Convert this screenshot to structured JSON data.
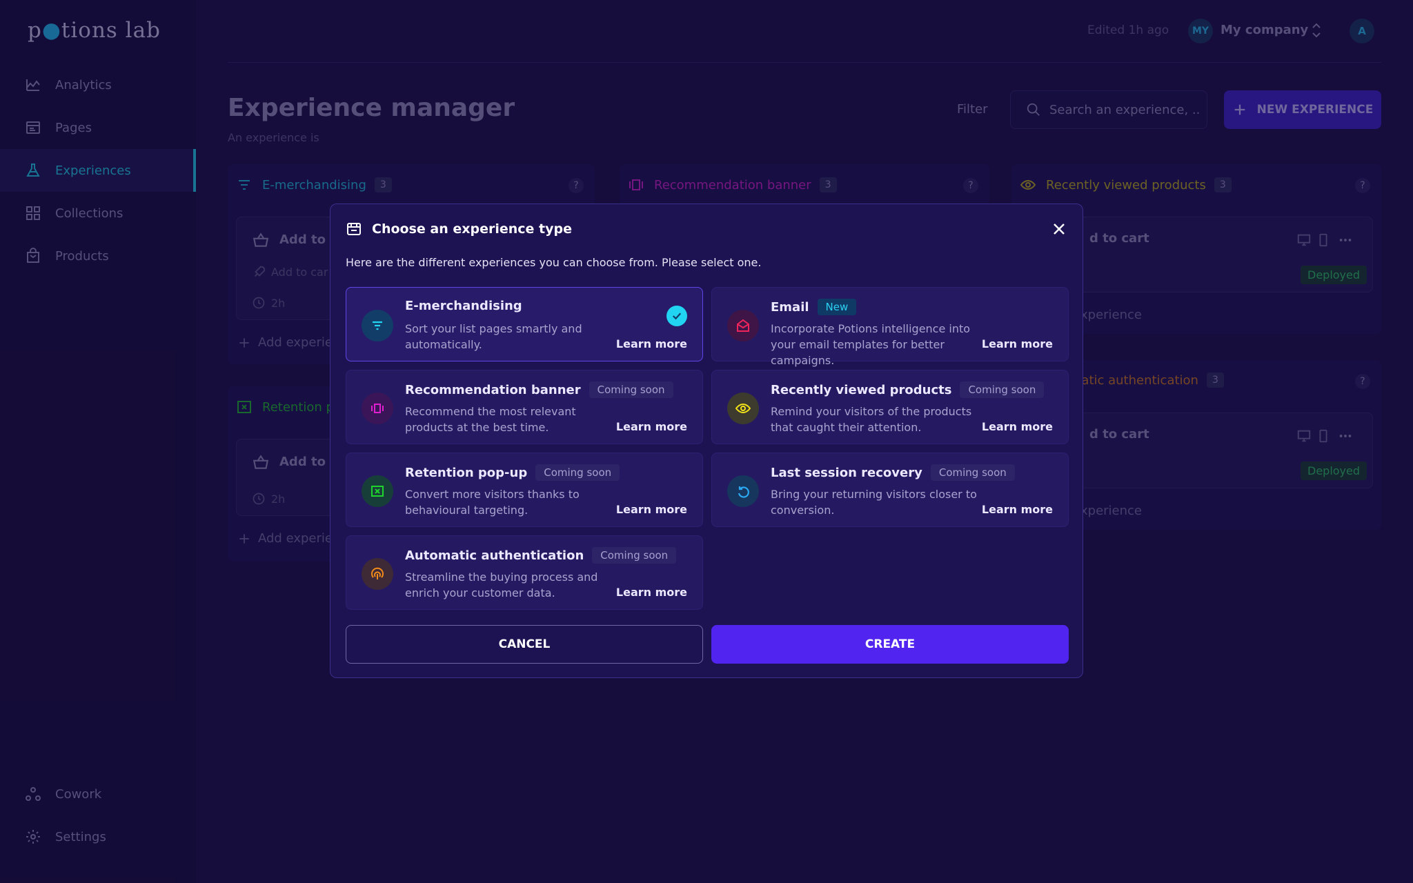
{
  "app": {
    "logo_text": "potions lab"
  },
  "sidebar": {
    "items": [
      {
        "label": "Analytics",
        "icon": "analytics-icon"
      },
      {
        "label": "Pages",
        "icon": "pages-icon"
      },
      {
        "label": "Experiences",
        "icon": "flask-icon",
        "active": true
      },
      {
        "label": "Collections",
        "icon": "grid-icon"
      },
      {
        "label": "Products",
        "icon": "bag-icon"
      }
    ],
    "bottom_items": [
      {
        "label": "Cowork",
        "icon": "cowork-icon"
      },
      {
        "label": "Settings",
        "icon": "gear-icon"
      }
    ]
  },
  "header": {
    "edited": "Edited 1h ago",
    "company_initials": "MY",
    "company_name": "My company",
    "user_initial": "A"
  },
  "main": {
    "title": "Experience manager",
    "subtitle": "An experience is",
    "filter_label": "Filter",
    "search_placeholder": "Search an experience, ...",
    "new_button": "NEW EXPERIENCE"
  },
  "columns": {
    "emerch": {
      "title": "E-merchandising",
      "count": "3",
      "card_title": "Add to ca",
      "card_sub": "Add to car",
      "time": "2h",
      "add": "Add experie"
    },
    "recbanner": {
      "title": "Recommendation banner",
      "count": "3"
    },
    "recent": {
      "title": "Recently viewed products",
      "count": "3",
      "card_title": "d to cart",
      "deployed": "Deployed",
      "add": "xperience"
    },
    "retention": {
      "title": "Retention p",
      "card_title": "Add to ca",
      "time": "2h",
      "add": "Add experie"
    },
    "autoauth": {
      "title": "natic authentication",
      "count": "3",
      "card_title": "d to cart",
      "deployed": "Deployed",
      "add": "xperience"
    },
    "help": "?"
  },
  "modal": {
    "title": "Choose an experience type",
    "description": "Here are the different experiences you can choose from. Please select one.",
    "cancel": "CANCEL",
    "create": "CREATE",
    "options": [
      {
        "title": "E-merchandising",
        "badge": "",
        "desc": "Sort your list pages smartly and automatically.",
        "learn": "Learn more",
        "selected": true,
        "icon": "filter-icon",
        "color": "#21d4f2"
      },
      {
        "title": "Email",
        "badge": "New",
        "desc": "Incorporate Potions intelligence into your email templates for better campaigns.",
        "learn": "Learn more",
        "icon": "mail-icon",
        "color": "#f0245c"
      },
      {
        "title": "Recommendation banner",
        "badge": "Coming soon",
        "desc": "Recommend the most relevant products at the best time.",
        "learn": "Learn more",
        "icon": "carousel-icon",
        "color": "#e020d0"
      },
      {
        "title": "Recently viewed products",
        "badge": "Coming soon",
        "desc": "Remind your visitors of the products that caught their attention.",
        "learn": "Learn more",
        "icon": "eye-icon",
        "color": "#f2e21a"
      },
      {
        "title": "Retention pop-up",
        "badge": "Coming soon",
        "desc": "Convert more visitors thanks to behavioural targeting.",
        "learn": "Learn more",
        "icon": "popup-icon",
        "color": "#1fd42c"
      },
      {
        "title": "Last session recovery",
        "badge": "Coming soon",
        "desc": "Bring your returning visitors closer to conversion.",
        "learn": "Learn more",
        "icon": "refresh-icon",
        "color": "#2aa8f2"
      },
      {
        "title": "Automatic authentication",
        "badge": "Coming soon",
        "desc": "Streamline the buying process and enrich your customer data.",
        "learn": "Learn more",
        "icon": "fingerprint-icon",
        "color": "#f28a1a"
      }
    ]
  }
}
